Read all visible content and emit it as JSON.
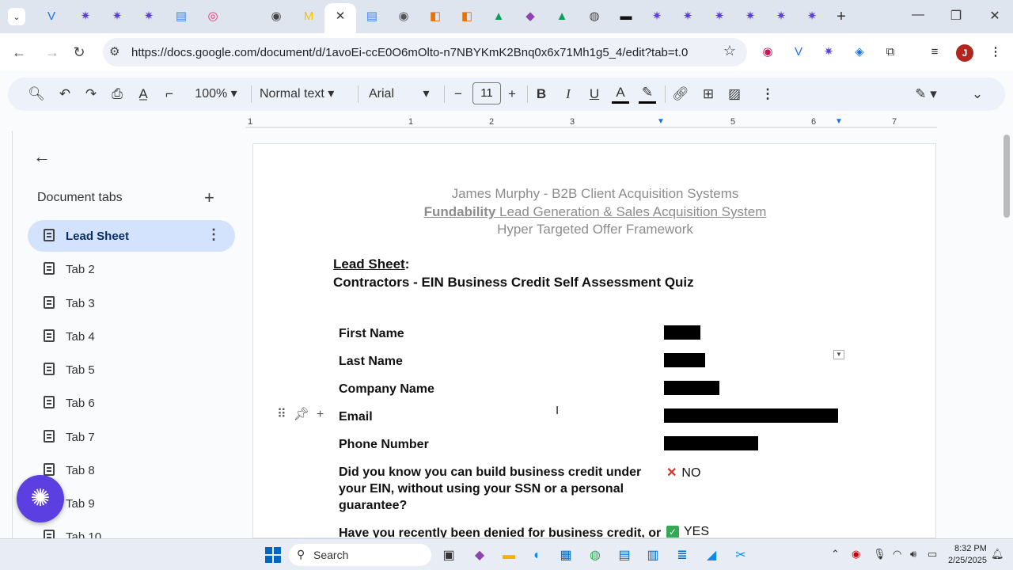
{
  "browser": {
    "tab_icons": [
      "tab-menu-icon",
      "vee-icon",
      "puzzle-icon",
      "puzzle-icon",
      "puzzle-icon",
      "docs-icon",
      "instagram-icon",
      "blank-tab",
      "globe-icon",
      "m-icon",
      "close-icon",
      "docs-icon",
      "globe-icon",
      "office-icon",
      "office-icon",
      "drive-icon",
      "copilot-icon",
      "drive-icon",
      "chrome-icon",
      "active-tab-icon",
      "puzzle-icon",
      "puzzle-icon",
      "puzzle-icon",
      "puzzle-icon",
      "puzzle-icon",
      "puzzle-icon",
      "new-tab-icon"
    ],
    "url": "https://docs.google.com/document/d/1avoEi-ccE0O6mOlto-n7NBYKmK2Bnq0x6x71Mh1g5_4/edit?tab=t.0",
    "avatar_letter": "J"
  },
  "toolbar": {
    "zoom": "100%",
    "style": "Normal text",
    "font": "Arial",
    "font_size": "11"
  },
  "ruler": {
    "marks": [
      "1",
      "1",
      "2",
      "3",
      "5",
      "6",
      "7"
    ]
  },
  "sidebar": {
    "title": "Document tabs",
    "tabs": [
      {
        "label": "Lead Sheet",
        "active": true
      },
      {
        "label": "Tab 2"
      },
      {
        "label": "Tab 3"
      },
      {
        "label": "Tab 4"
      },
      {
        "label": "Tab 5"
      },
      {
        "label": "Tab 6"
      },
      {
        "label": "Tab 7"
      },
      {
        "label": "Tab 8"
      },
      {
        "label": "Tab 9"
      },
      {
        "label": "Tab 10"
      }
    ]
  },
  "document": {
    "header_line1": "James Murphy - B2B Client Acquisition Systems",
    "header_line2_brand": "Fundability",
    "header_line2_rest": " Lead Generation & Sales Acquisition System",
    "header_line3": "Hyper Targeted Offer Framework",
    "lead_title": "Lead Sheet",
    "lead_colon": ":",
    "quiz_title": "Contractors - EIN Business Credit Self Assessment Quiz",
    "rows": [
      {
        "label": "First Name"
      },
      {
        "label": "Last Name"
      },
      {
        "label": "Company Name"
      },
      {
        "label": "Email"
      },
      {
        "label": "Phone Number"
      },
      {
        "label": "Did you know you can build business credit under your EIN, without using your SSN or a personal guarantee?",
        "answer": "NO"
      },
      {
        "label": "Have you recently been denied for business credit, or",
        "answer": "YES"
      }
    ]
  },
  "taskbar": {
    "search_label": "Search",
    "time": "8:32 PM",
    "date": "2/25/2025"
  },
  "colors": {
    "accent": "#0b57d0",
    "active_tab_bg": "#d3e3fd",
    "fab": "#5b3fe0"
  }
}
